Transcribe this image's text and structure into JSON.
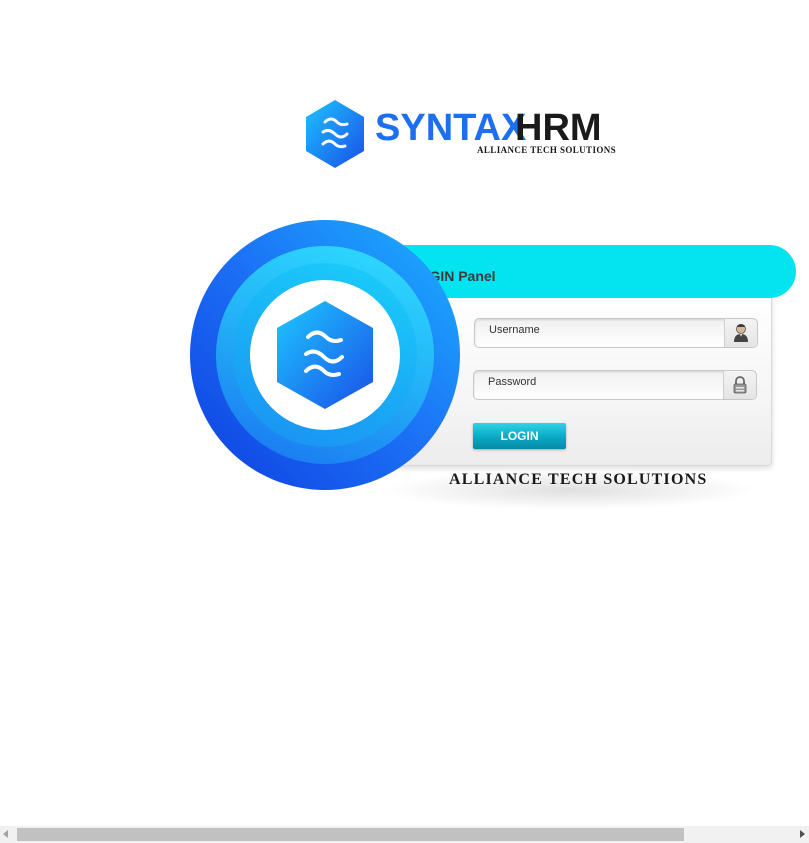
{
  "brand": {
    "name_part1": "SYNTAX",
    "name_part2": "HRM",
    "tagline_small": "ALLIANCE TECH SOLUTIONS",
    "logo_icon": "syntax-hexagon-logo"
  },
  "login_panel": {
    "title": "LOGIN Panel",
    "username_placeholder": "Username",
    "username_value": "",
    "username_icon": "user-icon",
    "password_placeholder": "Password",
    "password_value": "",
    "password_icon": "lock-icon",
    "submit_label": "LOGIN"
  },
  "footer_tagline": "ALLIANCE TECH SOLUTIONS",
  "colors": {
    "brand_blue": "#1d6ff2",
    "header_cyan": "#03e3f0",
    "button_teal": "#0aa8c4"
  }
}
